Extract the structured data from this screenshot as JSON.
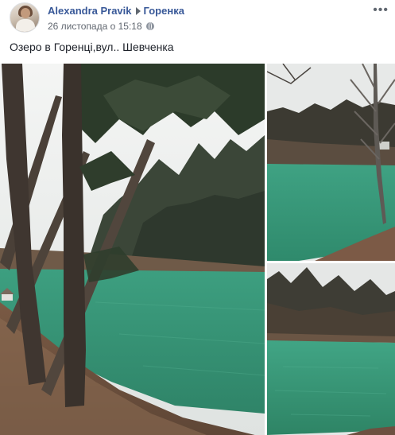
{
  "post": {
    "author": "Alexandra Pravik",
    "location": "Горенка",
    "timestamp": "26 листопада о 15:18",
    "privacy_icon": "globe-icon",
    "more_icon": "ellipsis-icon",
    "caption": "Озеро в Горенці,вул.. Шевченка"
  },
  "photos": [
    {
      "id": "main",
      "subject": "pine trees by green lake"
    },
    {
      "id": "top-right",
      "subject": "green lake with bare tree"
    },
    {
      "id": "bottom-right",
      "subject": "green lake with forest shore"
    }
  ],
  "colors": {
    "link": "#385898",
    "meta": "#616770",
    "lake_green": "#3a9a78"
  }
}
